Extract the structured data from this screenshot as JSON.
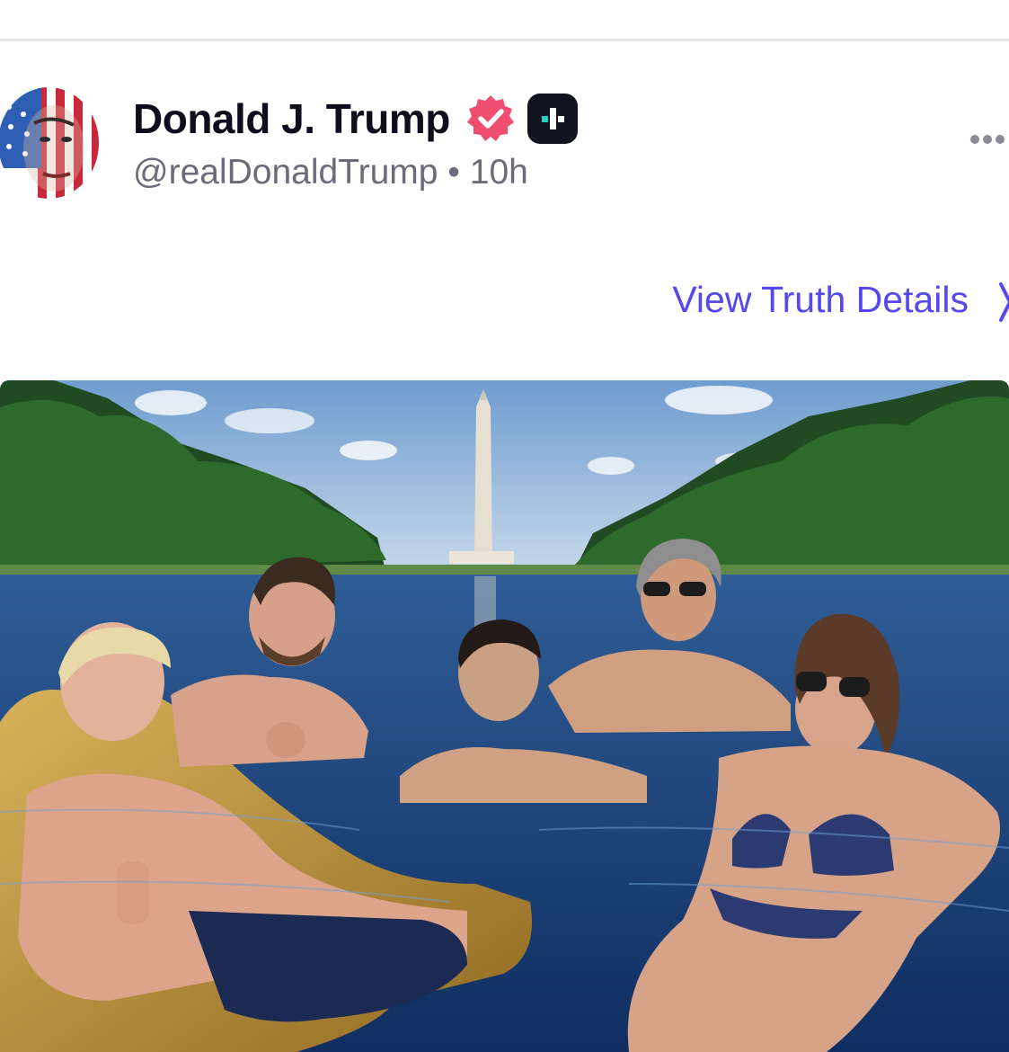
{
  "post": {
    "author_name": "Donald J. Trump",
    "handle": "@realDonaldTrump",
    "separator": "•",
    "time_ago": "10h",
    "view_details_label": "View Truth Details"
  },
  "icons": {
    "verified": "verified-badge-icon",
    "plus": "truth-plus-icon",
    "more": "more-options-icon",
    "chevron": "chevron-right-icon"
  },
  "colors": {
    "accent": "#5448ee",
    "verified": "#ef4e70",
    "name_text": "#0e0e1e",
    "meta_text": "#6b6b7b"
  }
}
